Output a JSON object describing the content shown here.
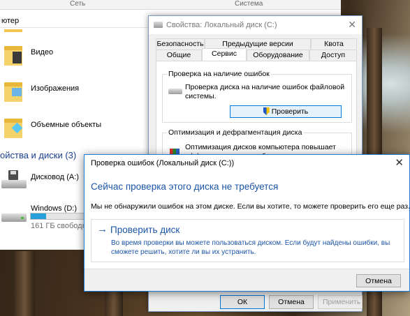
{
  "explorer": {
    "ribbon_left": "Сеть",
    "ribbon_right": "Система",
    "address_partial": "ютер",
    "folders": [
      {
        "label": "Видео"
      },
      {
        "label": "Изображения"
      },
      {
        "label": "Объемные объекты"
      }
    ],
    "devices_header": "ойства и диски (3)",
    "drives": [
      {
        "label": "Дисковод (A:)"
      },
      {
        "label": "Windows (D:)",
        "free": "161 ГБ свободно",
        "usage_fraction": 0.28
      }
    ]
  },
  "properties": {
    "title": "Свойства: Локальный диск (C:)",
    "close": "✕",
    "tabs_row1": [
      "Безопасность",
      "Предыдущие версии",
      "Квота"
    ],
    "tabs_row2": [
      "Общие",
      "Сервис",
      "Оборудование",
      "Доступ"
    ],
    "active_tab": "Сервис",
    "check_group": {
      "title": "Проверка на наличие ошибок",
      "description": "Проверка диска на наличие ошибок файловой системы.",
      "button": "Проверить"
    },
    "defrag_group": {
      "title": "Оптимизация и дефрагментация диска",
      "description": "Оптимизация дисков компьютера повышает эффективность его работы."
    },
    "buttons": {
      "ok": "ОК",
      "cancel": "Отмена",
      "apply": "Применить"
    }
  },
  "error_check": {
    "title": "Проверка ошибок (Локальный диск (C:))",
    "close": "✕",
    "heading": "Сейчас проверка этого диска не требуется",
    "message": "Мы не обнаружили ошибок на этом диске. Если вы хотите, то можете проверить его еще раз.",
    "option": {
      "arrow": "→",
      "title": "Проверить диск",
      "description": "Во время проверки вы можете пользоваться диском. Если будут найдены ошибки, вы сможете решить, хотите ли вы их устранить."
    },
    "cancel_button": "Отмена"
  },
  "colors": {
    "accent": "#1c55a6",
    "dialog_border": "#1e7bd8",
    "header_blue": "#1a3f8f"
  }
}
